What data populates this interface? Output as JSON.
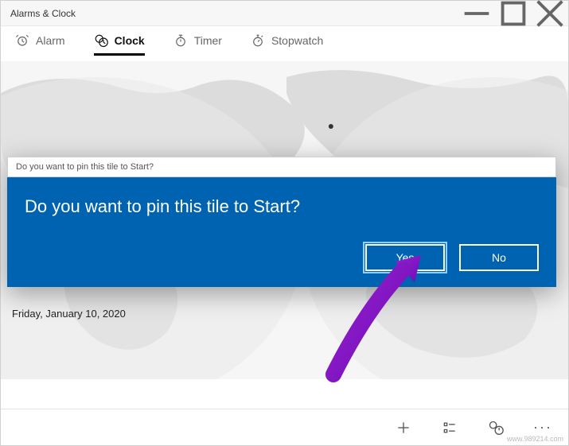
{
  "window": {
    "title": "Alarms & Clock"
  },
  "tabs": {
    "alarm": "Alarm",
    "clock": "Clock",
    "timer": "Timer",
    "stopwatch": "Stopwatch"
  },
  "date": "Friday, January 10, 2020",
  "dialog": {
    "header": "Do you want to pin this tile to Start?",
    "message": "Do you want to pin this tile to Start?",
    "yes": "Yes",
    "no": "No"
  },
  "watermark": "www.989214.com"
}
